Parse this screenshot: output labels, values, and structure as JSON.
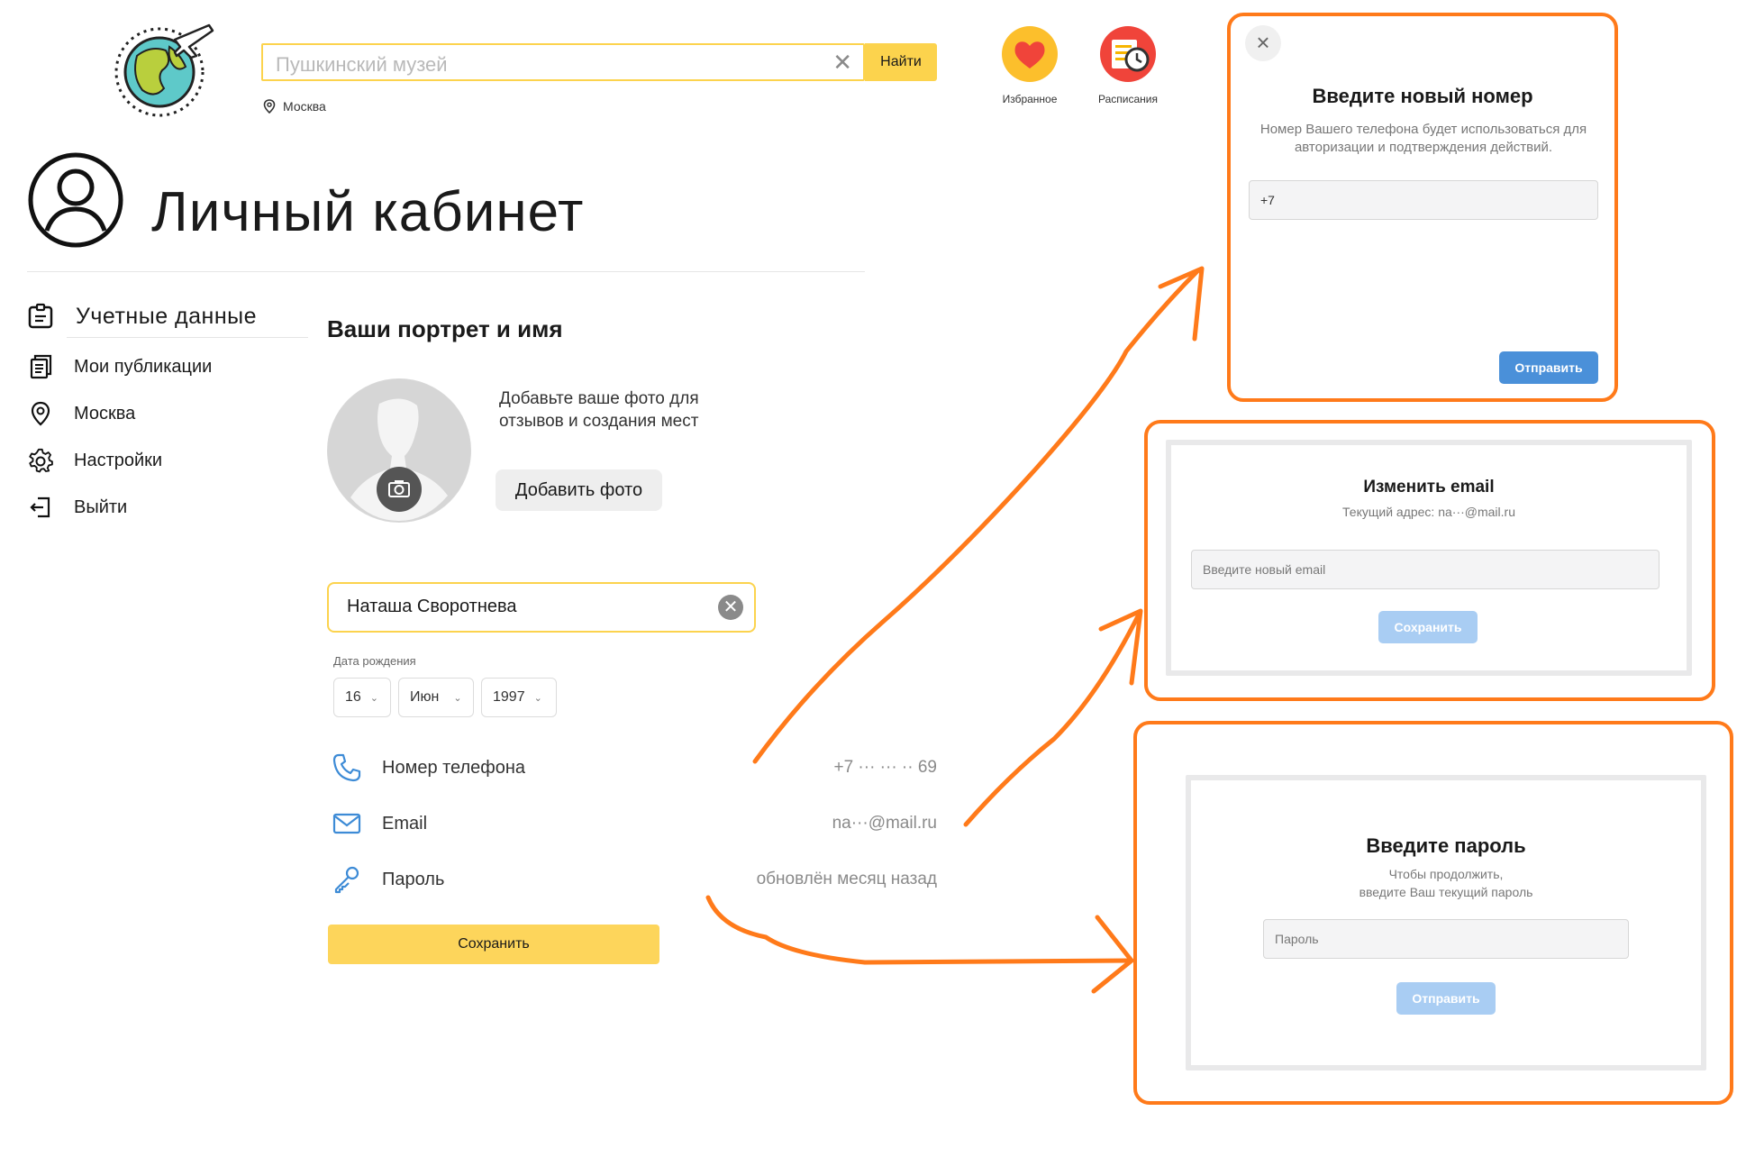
{
  "header": {
    "search_placeholder": "Пушкинский музей",
    "search_button": "Найти",
    "city": "Москва",
    "favorites_label": "Избранное",
    "schedules_label": "Расписания"
  },
  "page": {
    "title": "Личный кабинет"
  },
  "sidebar": {
    "items": [
      {
        "label": "Учетные данные"
      },
      {
        "label": "Мои публикации"
      },
      {
        "label": "Москва"
      },
      {
        "label": "Настройки"
      },
      {
        "label": "Выйти"
      }
    ]
  },
  "profile": {
    "section_title": "Ваши портрет и имя",
    "photo_hint": "Добавьте ваше фото для отзывов и создания мест",
    "add_photo_button": "Добавить фото",
    "name_value": "Наташа Своротнева",
    "dob_label": "Дата рождения",
    "dob_day": "16",
    "dob_month": "Июн",
    "dob_year": "1997",
    "phone_label": "Номер телефона",
    "phone_value": "+7 ··· ··· ·· 69",
    "email_label": "Email",
    "email_value": "na···@mail.ru",
    "password_label": "Пароль",
    "password_value": "обновлён месяц назад",
    "save_button": "Сохранить"
  },
  "phone_modal": {
    "close": "×",
    "title": "Введите новый номер",
    "subtitle": "Номер Вашего телефона будет использоваться для авторизации и подтверждения действий.",
    "input_value": "+7",
    "submit_button": "Отправить"
  },
  "email_modal": {
    "title": "Изменить email",
    "subtitle": "Текущий адрес: na···@mail.ru",
    "input_placeholder": "Введите новый email",
    "save_button": "Сохранить"
  },
  "password_modal": {
    "title": "Введите пароль",
    "subtitle_1": "Чтобы продолжить,",
    "subtitle_2": "введите Ваш текущий пароль",
    "input_placeholder": "Пароль",
    "submit_button": "Отправить"
  },
  "colors": {
    "accent_yellow": "#fcd34d",
    "annotation_orange": "#ff7a1a",
    "primary_blue": "#4a90d9",
    "disabled_blue": "#a9cdf3"
  }
}
